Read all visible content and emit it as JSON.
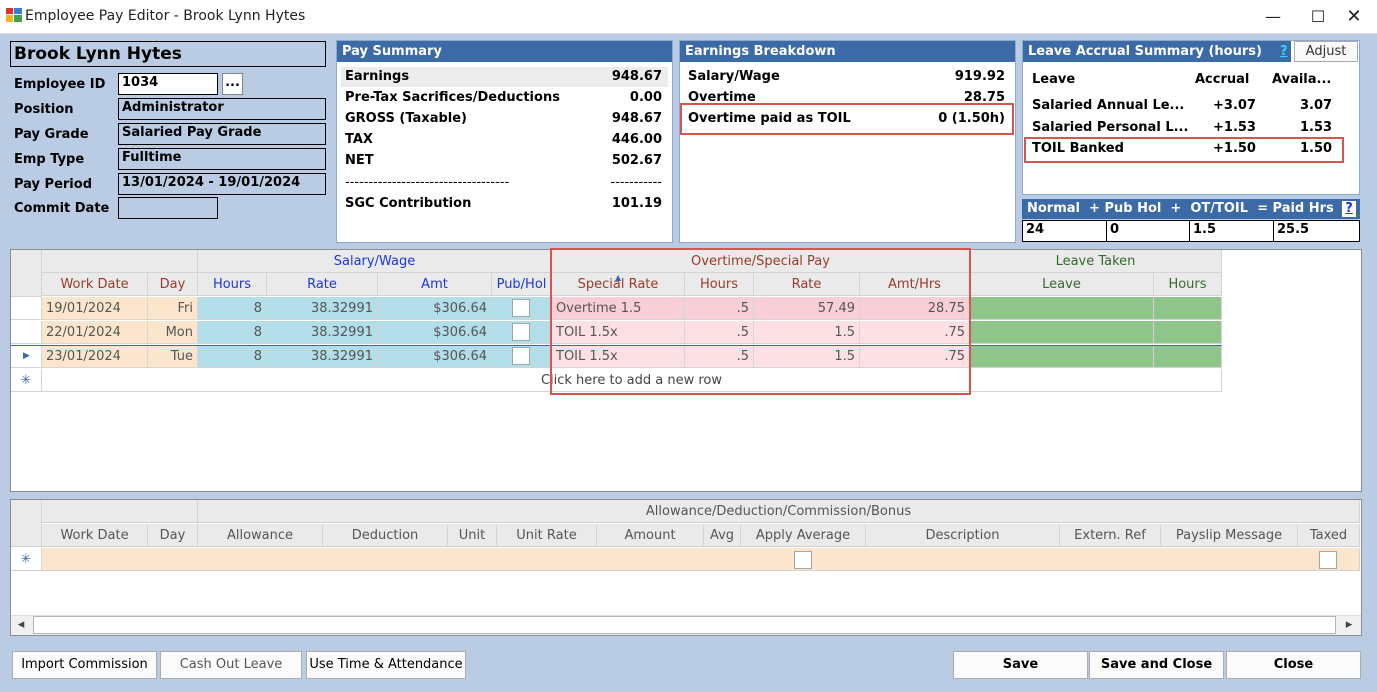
{
  "window": {
    "title": "Employee Pay Editor - Brook Lynn Hytes"
  },
  "employee": {
    "name": "Brook Lynn Hytes",
    "employee_id_label": "Employee ID",
    "employee_id": "1034",
    "lookup_label": "...",
    "position_label": "Position",
    "position": "Administrator",
    "pay_grade_label": "Pay Grade",
    "pay_grade": "Salaried Pay Grade",
    "emp_type_label": "Emp Type",
    "emp_type": "Fulltime",
    "pay_period_label": "Pay Period",
    "pay_period": "13/01/2024 - 19/01/2024",
    "commit_date_label": "Commit Date",
    "commit_date": ""
  },
  "pay_summary": {
    "title": "Pay Summary",
    "rows": [
      {
        "label": "Earnings",
        "value": "948.67"
      },
      {
        "label": "Pre-Tax Sacrifices/Deductions",
        "value": "0.00"
      },
      {
        "label": "GROSS (Taxable)",
        "value": "948.67"
      },
      {
        "label": "TAX",
        "value": "446.00"
      },
      {
        "label": "NET",
        "value": "502.67"
      }
    ],
    "divider_left": "-----------------------------------",
    "divider_right": "-----------",
    "sgc_label": "SGC Contribution",
    "sgc_value": "101.19"
  },
  "earnings": {
    "title": "Earnings Breakdown",
    "rows": [
      {
        "label": "Salary/Wage",
        "value": "919.92"
      },
      {
        "label": "Overtime",
        "value": "28.75"
      },
      {
        "label": "Overtime paid as TOIL",
        "value": "0 (1.50h)"
      }
    ]
  },
  "leave_accrual": {
    "title": "Leave Accrual Summary (hours)",
    "help": "?",
    "adjust_label": "Adjust",
    "headers": {
      "leave": "Leave",
      "accrual": "Accrual",
      "available": "Availa..."
    },
    "rows": [
      {
        "leave": "Salaried Annual Le...",
        "accrual": "+3.07",
        "available": "3.07"
      },
      {
        "leave": "Salaried Personal L...",
        "accrual": "+1.53",
        "available": "1.53"
      },
      {
        "leave": "TOIL Banked",
        "accrual": "+1.50",
        "available": "1.50"
      }
    ]
  },
  "hours_bar": {
    "label": "Normal  + Pub Hol  +  OT/TOIL  = Paid Hrs",
    "help": "?",
    "normal": "24",
    "pub_hol": "0",
    "ot_toil": "1.5",
    "paid_hrs": "25.5"
  },
  "timesheet": {
    "group_salary": "Salary/Wage",
    "group_overtime": "Overtime/Special Pay",
    "group_leave": "Leave Taken",
    "headers": {
      "work_date": "Work Date",
      "day": "Day",
      "hours": "Hours",
      "rate": "Rate",
      "amt": "Amt",
      "pub_hol": "Pub/Hol",
      "special_rate": "Special Rate",
      "ot_hours": "Hours",
      "ot_rate": "Rate",
      "amt_hrs": "Amt/Hrs",
      "leave": "Leave",
      "leave_hours": "Hours"
    },
    "rows": [
      {
        "date": "19/01/2024",
        "day": "Fri",
        "hours": "8",
        "rate": "38.32991",
        "amt": "$306.64",
        "special": "Overtime 1.5",
        "ot_hours": ".5",
        "ot_rate": "57.49",
        "amt_hrs": "28.75"
      },
      {
        "date": "22/01/2024",
        "day": "Mon",
        "hours": "8",
        "rate": "38.32991",
        "amt": "$306.64",
        "special": "TOIL 1.5x",
        "ot_hours": ".5",
        "ot_rate": "1.5",
        "amt_hrs": ".75"
      },
      {
        "date": "23/01/2024",
        "day": "Tue",
        "hours": "8",
        "rate": "38.32991",
        "amt": "$306.64",
        "special": "TOIL 1.5x",
        "ot_hours": ".5",
        "ot_rate": "1.5",
        "amt_hrs": ".75"
      }
    ],
    "new_row": "Click here to add a new row",
    "new_row_marker": "✳",
    "current_marker": "▶"
  },
  "allowance": {
    "group": "Allowance/Deduction/Commission/Bonus",
    "headers": {
      "work_date": "Work Date",
      "day": "Day",
      "allowance": "Allowance",
      "deduction": "Deduction",
      "unit": "Unit",
      "unit_rate": "Unit Rate",
      "amount": "Amount",
      "avg": "Avg",
      "apply_average": "Apply Average",
      "description": "Description",
      "extern_ref": "Extern. Ref",
      "payslip_message": "Payslip Message",
      "taxed": "Taxed"
    },
    "new_row_marker": "✳"
  },
  "scrollbar": {
    "left": "◂",
    "right": "▸"
  },
  "buttons": {
    "import_commission": "Import Commission",
    "cash_out_leave": "Cash Out Leave",
    "use_time_attendance": "Use Time & Attendance",
    "save": "Save",
    "save_and_close": "Save and Close",
    "close": "Close"
  },
  "colors": {
    "header_blue": "#3b6aa6",
    "client_bg": "#b9cce4",
    "highlight_red": "#d9534f",
    "salary_cell": "#b3dde8",
    "overtime_cell": "#f8cfd6",
    "leave_cell": "#8fc48b",
    "date_cell": "#fbe6cd"
  }
}
